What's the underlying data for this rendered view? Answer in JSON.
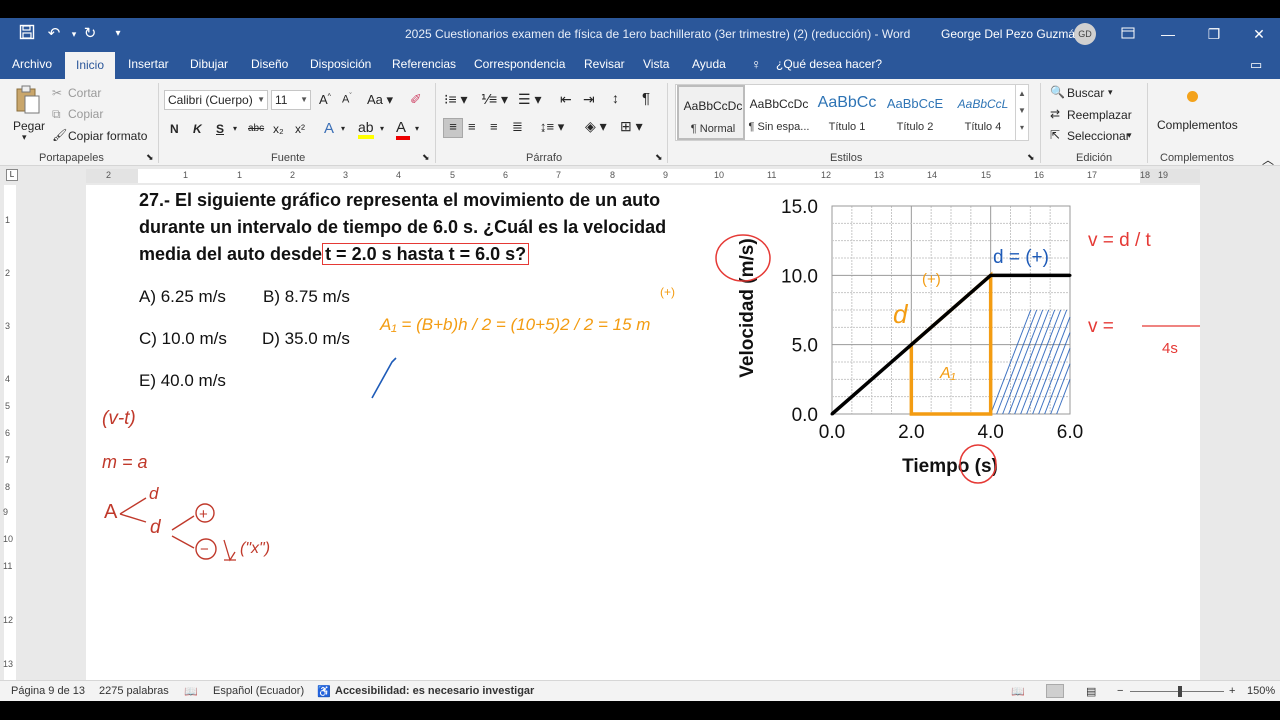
{
  "window": {
    "title": "2025 Cuestionarios examen de física de 1ero bachillerato (3er trimestre) (2) (reducción)  -  Word",
    "user": "George Del Pezo Guzmán",
    "avatar_initials": "GD"
  },
  "tabs": [
    "Archivo",
    "Inicio",
    "Insertar",
    "Dibujar",
    "Diseño",
    "Disposición",
    "Referencias",
    "Correspondencia",
    "Revisar",
    "Vista",
    "Ayuda"
  ],
  "active_tab": "Inicio",
  "tell_me": "¿Qué desea hacer?",
  "ribbon": {
    "clipboard": {
      "paste": "Pegar",
      "cut": "Cortar",
      "copy": "Copiar",
      "format_painter": "Copiar formato",
      "label": "Portapapeles"
    },
    "font": {
      "name": "Calibri (Cuerpo)",
      "size": "11",
      "label": "Fuente",
      "bold": "N",
      "italic": "K",
      "underline": "S",
      "strike": "abc",
      "sub": "x₂",
      "sup": "x²"
    },
    "paragraph": {
      "label": "Párrafo"
    },
    "styles": {
      "label": "Estilos",
      "items": [
        {
          "sample": "AaBbCcDc",
          "name": "¶ Normal"
        },
        {
          "sample": "AaBbCcDc",
          "name": "¶ Sin espa..."
        },
        {
          "sample": "AaBbCc",
          "name": "Título 1"
        },
        {
          "sample": "AaBbCcE",
          "name": "Título 2"
        },
        {
          "sample": "AaBbCcL",
          "name": "Título 4"
        }
      ]
    },
    "editing": {
      "find": "Buscar",
      "replace": "Reemplazar",
      "select": "Seleccionar",
      "label": "Edición"
    },
    "addins": {
      "button": "Complementos",
      "label": "Complementos"
    }
  },
  "ruler": {
    "h_numbers": [
      "2",
      "1",
      "1",
      "2",
      "3",
      "4",
      "5",
      "6",
      "7",
      "8",
      "9",
      "10",
      "11",
      "12",
      "13",
      "14",
      "15",
      "16",
      "17",
      "18",
      "19"
    ],
    "v_numbers": [
      "1",
      "2",
      "3",
      "4",
      "5",
      "6",
      "7",
      "8",
      "9",
      "10",
      "11",
      "12",
      "13"
    ]
  },
  "question": {
    "line1": "27.- El siguiente gráfico representa el movimiento de un auto",
    "line2": "durante un intervalo de tiempo de 6.0 s. ¿Cuál es la velocidad",
    "line3_pre": "media del auto desde",
    "line3_highlight": "t = 2.0 s hasta t = 6.0 s?",
    "options": {
      "A": "A) 6.25 m/s",
      "B": "B) 8.75 m/s",
      "C": "C) 10.0 m/s",
      "D": "D) 35.0 m/s",
      "E": "E) 40.0 m/s"
    }
  },
  "chart_data": {
    "type": "line",
    "xlabel": "Tiempo (s)",
    "ylabel": "Velocidad (m/s)",
    "x_ticks": [
      "0.0",
      "2.0",
      "4.0",
      "6.0"
    ],
    "y_ticks": [
      "0.0",
      "5.0",
      "10.0",
      "15.0"
    ],
    "xlim": [
      0,
      6
    ],
    "ylim": [
      0,
      15
    ],
    "grid": true,
    "series": [
      {
        "x": [
          0,
          4,
          6
        ],
        "y": [
          0,
          10,
          10
        ]
      }
    ]
  },
  "annotations": {
    "area_formula": "A₁ = (B+b)h / 2 = (10+5)2 / 2 = 15 m",
    "plus_sign": "(+)",
    "a1_label": "A₁",
    "d_label": "d",
    "d_plus": "d = (+)",
    "v_formula_1": "v = d / t",
    "v_formula_2": "v =",
    "time_4s": "4s",
    "note_vt": "(v-t)",
    "note_m": "m = a",
    "note_a": "A",
    "note_d": "d",
    "note_plus": "+",
    "note_minus": "−",
    "note_x": "(\"x\")"
  },
  "status": {
    "page": "Página 9 de 13",
    "words": "2275 palabras",
    "language": "Español (Ecuador)",
    "accessibility": "Accesibilidad: es necesario investigar",
    "zoom": "150%"
  },
  "colors": {
    "word_blue": "#2b579a",
    "ink_orange": "#f39c12",
    "ink_red": "#e53935",
    "ink_blue": "#1e5bb8"
  }
}
